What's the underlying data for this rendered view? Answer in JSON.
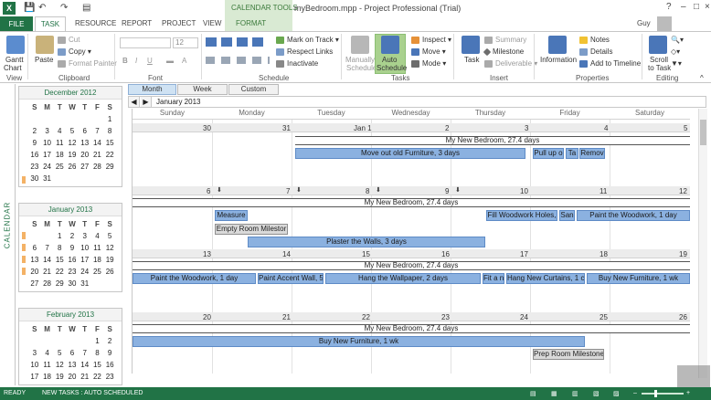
{
  "window": {
    "app_badge": "X",
    "document_title": "myBedroom.mpp - Project Professional (Trial)",
    "context_group": "CALENDAR TOOLS",
    "user_name": "Guy"
  },
  "tabs": {
    "file": "FILE",
    "task": "TASK",
    "resource": "RESOURCE",
    "report": "REPORT",
    "project": "PROJECT",
    "view": "VIEW",
    "format": "FORMAT"
  },
  "ribbon": {
    "view_group": {
      "gantt_chart": "Gantt",
      "gantt_chart2": "Chart",
      "label": "View"
    },
    "clipboard": {
      "paste": "Paste",
      "cut": "Cut",
      "copy": "Copy",
      "format_painter": "Format Painter",
      "label": "Clipboard"
    },
    "font": {
      "size": "12",
      "label": "Font",
      "bold": "B",
      "italic": "I",
      "underline": "U"
    },
    "schedule": {
      "mark_on_track": "Mark on Track",
      "respect_links": "Respect Links",
      "inactivate": "Inactivate",
      "label": "Schedule"
    },
    "tasks": {
      "manually": "Manually",
      "manually2": "Schedule",
      "auto": "Auto",
      "auto2": "Schedule",
      "inspect": "Inspect",
      "move": "Move",
      "mode": "Mode",
      "label": "Tasks"
    },
    "insert": {
      "task": "Task",
      "summary": "Summary",
      "milestone": "Milestone",
      "deliverable": "Deliverable",
      "label": "Insert"
    },
    "properties": {
      "information": "Information",
      "notes": "Notes",
      "details": "Details",
      "add_to_timeline": "Add to Timeline",
      "label": "Properties"
    },
    "editing": {
      "scroll": "Scroll",
      "to_task": "to Task",
      "label": "Editing"
    }
  },
  "view_switcher": {
    "month": "Month",
    "week": "Week",
    "custom": "Custom"
  },
  "nav": {
    "prev": "◀",
    "next": "▶",
    "current_month": "January 2013"
  },
  "side_label": "CALENDAR",
  "mini_calendars": [
    {
      "title": "December 2012",
      "days_header": [
        "S",
        "M",
        "T",
        "W",
        "T",
        "F",
        "S"
      ],
      "cells": [
        "",
        "",
        "",
        "",
        "",
        "",
        "1",
        "2",
        "3",
        "4",
        "5",
        "6",
        "7",
        "8",
        "9",
        "10",
        "11",
        "12",
        "13",
        "14",
        "15",
        "16",
        "17",
        "18",
        "19",
        "20",
        "21",
        "22",
        "23",
        "24",
        "25",
        "26",
        "27",
        "28",
        "29",
        "30",
        "31",
        "",
        "",
        "",
        "",
        ""
      ]
    },
    {
      "title": "January 2013",
      "days_header": [
        "S",
        "M",
        "T",
        "W",
        "T",
        "F",
        "S"
      ],
      "cells": [
        "",
        "",
        "1",
        "2",
        "3",
        "4",
        "5",
        "6",
        "7",
        "8",
        "9",
        "10",
        "11",
        "12",
        "13",
        "14",
        "15",
        "16",
        "17",
        "18",
        "19",
        "20",
        "21",
        "22",
        "23",
        "24",
        "25",
        "26",
        "27",
        "28",
        "29",
        "30",
        "31",
        "",
        ""
      ]
    },
    {
      "title": "February 2013",
      "days_header": [
        "S",
        "M",
        "T",
        "W",
        "T",
        "F",
        "S"
      ],
      "cells": [
        "",
        "",
        "",
        "",
        "",
        "1",
        "2",
        "3",
        "4",
        "5",
        "6",
        "7",
        "8",
        "9",
        "10",
        "11",
        "12",
        "13",
        "14",
        "15",
        "16",
        "17",
        "18",
        "19",
        "20",
        "21",
        "22",
        "23"
      ]
    }
  ],
  "calendar": {
    "day_names": [
      "Sunday",
      "Monday",
      "Tuesday",
      "Wednesday",
      "Thursday",
      "Friday",
      "Saturday"
    ],
    "weeks": [
      {
        "dates": [
          "30",
          "31",
          "Jan 1",
          "2",
          "3",
          "4",
          "5"
        ]
      },
      {
        "dates": [
          "6",
          "7",
          "8",
          "9",
          "10",
          "11",
          "12"
        ]
      },
      {
        "dates": [
          "13",
          "14",
          "15",
          "16",
          "17",
          "18",
          "19"
        ]
      },
      {
        "dates": [
          "20",
          "21",
          "22",
          "23",
          "24",
          "25",
          "26"
        ]
      }
    ],
    "summary_label": "My New Bedroom, 27.4 days",
    "tasks": {
      "w1_move_out": "Move out old Furniture, 3 days",
      "w1_pull": "Pull up o",
      "w1_ta": "Ta",
      "w1_remove": "Remov",
      "w2_measure": "Measure",
      "w2_empty": "Empty Room Milestor",
      "w2_plaster": "Plaster the Walls, 3 days",
      "w2_fill": "Fill Woodwork Holes,",
      "w2_san": "San",
      "w2_paint_wood": "Paint the Woodwork, 1 day",
      "w3_paint_wood": "Paint the Woodwork, 1 day",
      "w3_accent": "Paint Accent Wall, 5",
      "w3_hang_wall": "Hang the Wallpaper, 2 days",
      "w3_fit": "Fit a n",
      "w3_hang_curtains": "Hang New Curtains, 1 c",
      "w3_buy": "Buy New Furniture, 1 wk",
      "w4_buy": "Buy New Furniture, 1 wk",
      "w4_prep": "Prep Room Milestone"
    }
  },
  "status": {
    "ready": "READY",
    "new_tasks": "NEW TASKS : AUTO SCHEDULED"
  }
}
